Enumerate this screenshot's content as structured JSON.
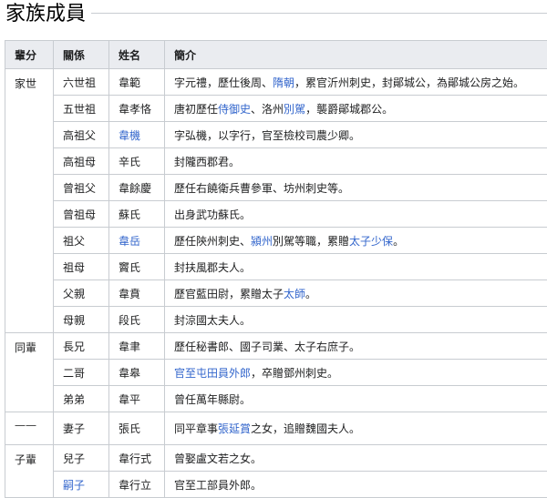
{
  "section_title": "家族成員",
  "columns": [
    "輩分",
    "關係",
    "姓名",
    "簡介"
  ],
  "groups": [
    {
      "generation": "家世",
      "rows": [
        {
          "relation": "六世祖",
          "name": "韋範",
          "name_link": false,
          "intro": [
            {
              "t": "字元禮，歷仕後周、"
            },
            {
              "t": "隋朝",
              "link": true
            },
            {
              "t": "，累官沂州刺史，封鄖城公，為鄖城公房之始。"
            }
          ]
        },
        {
          "relation": "五世祖",
          "name": "韋孝恪",
          "name_link": false,
          "intro": [
            {
              "t": "唐初歷任"
            },
            {
              "t": "侍御史",
              "link": true
            },
            {
              "t": "、洛州"
            },
            {
              "t": "別駕",
              "link": true
            },
            {
              "t": "，襲爵鄖城郡公。"
            }
          ]
        },
        {
          "relation": "高祖父",
          "name": "韋機",
          "name_link": true,
          "intro": [
            {
              "t": "字弘機，以字行，官至檢校司農少卿。"
            }
          ]
        },
        {
          "relation": "高祖母",
          "name": "辛氏",
          "name_link": false,
          "intro": [
            {
              "t": "封隴西郡君。"
            }
          ]
        },
        {
          "relation": "曾祖父",
          "name": "韋餘慶",
          "name_link": false,
          "intro": [
            {
              "t": "歷任右饒衛兵曹參軍、坊州刺史等。"
            }
          ]
        },
        {
          "relation": "曾祖母",
          "name": "蘇氏",
          "name_link": false,
          "intro": [
            {
              "t": "出身武功蘇氏。"
            }
          ]
        },
        {
          "relation": "祖父",
          "name": "韋岳",
          "name_link": true,
          "intro": [
            {
              "t": "歷任陝州刺史、"
            },
            {
              "t": "潁州",
              "link": true
            },
            {
              "t": "別駕等職，累贈"
            },
            {
              "t": "太子少保",
              "link": true
            },
            {
              "t": "。"
            }
          ]
        },
        {
          "relation": "祖母",
          "name": "竇氏",
          "name_link": false,
          "intro": [
            {
              "t": "封扶風郡夫人。"
            }
          ]
        },
        {
          "relation": "父親",
          "name": "韋賁",
          "name_link": false,
          "intro": [
            {
              "t": "歷官藍田尉，累贈太子"
            },
            {
              "t": "太師",
              "link": true
            },
            {
              "t": "。"
            }
          ]
        },
        {
          "relation": "母親",
          "name": "段氏",
          "name_link": false,
          "intro": [
            {
              "t": "封涼國太夫人。"
            }
          ]
        }
      ]
    },
    {
      "generation": "同輩",
      "rows": [
        {
          "relation": "長兄",
          "name": "韋聿",
          "name_link": false,
          "intro": [
            {
              "t": "歷任秘書郎、國子司業、太子右庶子。"
            }
          ]
        },
        {
          "relation": "二哥",
          "name": "韋皋",
          "name_link": false,
          "intro": [
            {
              "t": "官至屯田員外郎",
              "link": true
            },
            {
              "t": "，卒贈鄧州刺史。"
            }
          ]
        },
        {
          "relation": "弟弟",
          "name": "韋平",
          "name_link": false,
          "intro": [
            {
              "t": "曾任萬年縣尉。"
            }
          ]
        }
      ]
    },
    {
      "generation": "——",
      "rows": [
        {
          "relation": "妻子",
          "name": "張氏",
          "name_link": false,
          "intro": [
            {
              "t": "同平章事"
            },
            {
              "t": "張延賞",
              "link": true
            },
            {
              "t": "之女，追贈魏國夫人。"
            }
          ]
        }
      ]
    },
    {
      "generation": "子輩",
      "rows": [
        {
          "relation": "兒子",
          "name": "韋行式",
          "name_link": false,
          "intro": [
            {
              "t": "曾娶盧文若之女。"
            }
          ]
        },
        {
          "relation": "嗣子",
          "name": "韋行立",
          "name_link": false,
          "relation_link": true,
          "intro": [
            {
              "t": "官至工部員外郎。"
            }
          ]
        }
      ]
    }
  ],
  "colors": {
    "link": "#3366cc",
    "header_bg": "#eaecf0",
    "border": "#c8ccd1"
  }
}
